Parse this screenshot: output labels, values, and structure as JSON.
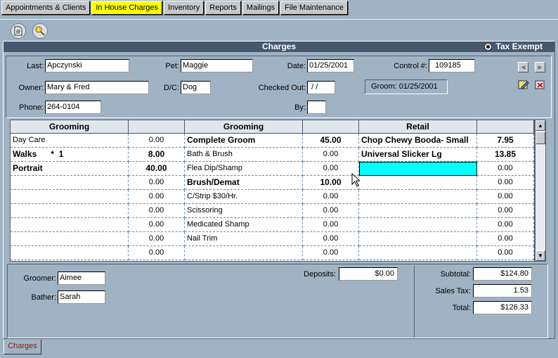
{
  "tabs": [
    {
      "label": "Appointments & Clients",
      "active": false
    },
    {
      "label": "In House Charges",
      "active": true
    },
    {
      "label": "Inventory",
      "active": false
    },
    {
      "label": "Reports",
      "active": false
    },
    {
      "label": "Mailings",
      "active": false
    },
    {
      "label": "File Maintenance",
      "active": false
    }
  ],
  "toolbar": {
    "icons": [
      "document-icon",
      "key-search-icon"
    ]
  },
  "panel": {
    "title": "Charges",
    "tax_exempt_label": "Tax Exempt",
    "tax_exempt_selected": true
  },
  "info": {
    "last_label": "Last:",
    "last_value": "Apczynski",
    "pet_label": "Pet:",
    "pet_value": "Maggie",
    "date_label": "Date:",
    "date_value": "01/25/2001",
    "control_label": "Control #:",
    "control_value": "109185",
    "owner_label": "Owner:",
    "owner_value": "Mary & Fred",
    "dc_label": "D/C:",
    "dc_value": "Dog",
    "checked_out_label": "Checked Out:",
    "checked_out_value": " / /",
    "groom_text": "Groom: 01/25/2001",
    "phone_label": "Phone:",
    "phone_value": "264-0104",
    "by_label": "By:",
    "by_value": ""
  },
  "grid": {
    "headers": [
      "Grooming",
      "",
      "Grooming",
      "",
      "Retail",
      ""
    ],
    "rows": [
      [
        "Day Care",
        "0.00",
        "Complete Groom",
        "45.00",
        "Chop Chewy Booda- Small",
        "7.95"
      ],
      [
        "Walks      *  1",
        "8.00",
        "Bath & Brush",
        "0.00",
        "Universal Slicker Lg",
        "13.85"
      ],
      [
        "Portrait",
        "40.00",
        "Flea Dip/Shamp",
        "0.00",
        "",
        "0.00"
      ],
      [
        "",
        "0.00",
        "Brush/Demat",
        "10.00",
        "",
        "0.00"
      ],
      [
        "",
        "0.00",
        "C/Strip $30/Hr.",
        "0.00",
        "",
        "0.00"
      ],
      [
        "",
        "0.00",
        "Scissoring",
        "0.00",
        "",
        "0.00"
      ],
      [
        "",
        "0.00",
        "Medicated Shamp",
        "0.00",
        "",
        "0.00"
      ],
      [
        "",
        "0.00",
        "Nail Trim",
        "0.00",
        "",
        "0.00"
      ],
      [
        "",
        "0.00",
        "",
        "0.00",
        "",
        "0.00"
      ]
    ]
  },
  "footer": {
    "groomer_label": "Groomer:",
    "groomer_value": "Aimee",
    "bather_label": "Bather:",
    "bather_value": "Sarah",
    "deposits_label": "Deposits:",
    "deposits_value": "$0.00",
    "subtotal_label": "Subtotal:",
    "subtotal_value": "$124.80",
    "sales_tax_label": "Sales Tax:",
    "sales_tax_value": "1.53",
    "total_label": "Total:",
    "total_value": "$126.33"
  },
  "bottom_tab": {
    "label": "Charges"
  },
  "colors": {
    "active_tab": "#ffff00",
    "title_bar": "#45586e",
    "selected_cell": "#00ffff",
    "background": "#9fb3c4"
  }
}
